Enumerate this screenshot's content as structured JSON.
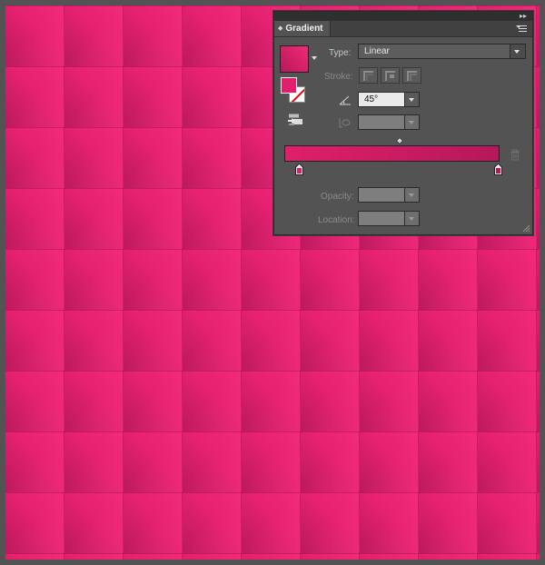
{
  "canvas": {
    "fill_start_color": "#f22a7a",
    "fill_end_color": "#b9195a",
    "pattern": "pink gradient checker tiles"
  },
  "panel": {
    "title": "Gradient",
    "type_label": "Type:",
    "type_value": "Linear",
    "stroke_label": "Stroke:",
    "angle_value": "45°",
    "opacity_label": "Opacity:",
    "opacity_value": "",
    "location_label": "Location:",
    "location_value": "",
    "aspect_value": "",
    "gradient_start_color": "#e01f6a",
    "gradient_end_color": "#b5185a",
    "fill_color": "#e0206c"
  },
  "icons": {
    "collapse": "collapse-double-arrow-icon",
    "menu": "panel-menu-icon",
    "angle": "angle-icon",
    "aspect": "aspect-ratio-icon",
    "reverse": "reverse-gradient-icon",
    "trash": "trash-icon"
  }
}
